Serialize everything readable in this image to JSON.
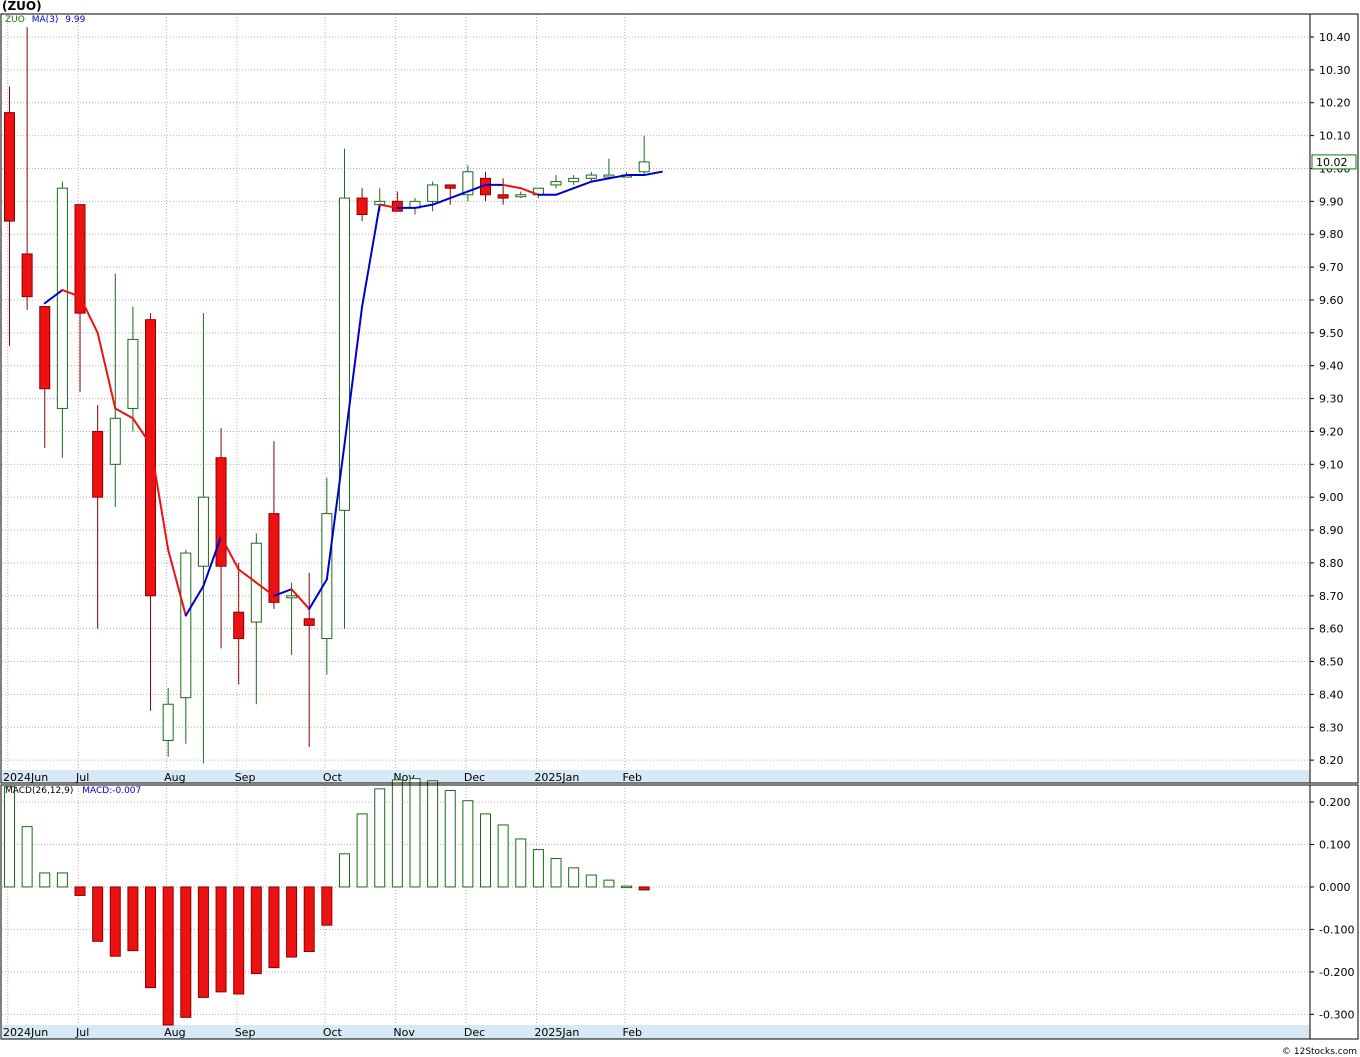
{
  "header": {
    "title": "(ZUO)"
  },
  "price_legend": {
    "symbol": "ZUO",
    "ma_label": "MA(3)",
    "ma_value": "9.99"
  },
  "macd_legend": {
    "label": "MACD(26,12,9)",
    "value": "MACD:-0.007"
  },
  "footer": {
    "credit": "© 12Stocks.com"
  },
  "colors": {
    "up_body": "#ffffff",
    "up_outline": "#1a6b1a",
    "down_body": "#ee1111",
    "down_wick": "#8b0000",
    "ma_up": "#0000cc",
    "ma_down": "#ee1111",
    "grid": "#b4b4b4",
    "axis_band": "#d7e9f5",
    "last_price_box": "#008000"
  },
  "chart_data": [
    {
      "type": "candlestick",
      "title": "(ZUO)",
      "interval": "weekly",
      "ylim": [
        8.17,
        10.47
      ],
      "y_ticks": [
        "8.20",
        "8.30",
        "8.40",
        "8.50",
        "8.60",
        "8.70",
        "8.80",
        "8.90",
        "9.00",
        "9.10",
        "9.20",
        "9.30",
        "9.40",
        "9.50",
        "9.60",
        "9.70",
        "9.80",
        "9.90",
        "10.00",
        "10.10",
        "10.20",
        "10.30",
        "10.40"
      ],
      "x_labels": [
        "2024Jun",
        "Jul",
        "Aug",
        "Sep",
        "Oct",
        "Nov",
        "Dec",
        "2025Jan",
        "Feb"
      ],
      "x_label_bars": [
        0,
        4,
        9,
        13,
        18,
        22,
        26,
        30,
        35
      ],
      "last_price": "10.02",
      "bars": [
        {
          "o": 10.17,
          "h": 10.25,
          "l": 9.46,
          "c": 9.84
        },
        {
          "o": 9.74,
          "h": 10.43,
          "l": 9.57,
          "c": 9.61
        },
        {
          "o": 9.58,
          "h": 9.58,
          "l": 9.15,
          "c": 9.33
        },
        {
          "o": 9.27,
          "h": 9.96,
          "l": 9.12,
          "c": 9.94
        },
        {
          "o": 9.89,
          "h": 9.89,
          "l": 9.32,
          "c": 9.56
        },
        {
          "o": 9.2,
          "h": 9.28,
          "l": 8.6,
          "c": 9.0
        },
        {
          "o": 9.1,
          "h": 9.68,
          "l": 8.97,
          "c": 9.24
        },
        {
          "o": 9.27,
          "h": 9.58,
          "l": 9.2,
          "c": 9.48
        },
        {
          "o": 9.54,
          "h": 9.56,
          "l": 8.35,
          "c": 8.7
        },
        {
          "o": 8.26,
          "h": 8.42,
          "l": 8.21,
          "c": 8.37
        },
        {
          "o": 8.39,
          "h": 8.84,
          "l": 8.25,
          "c": 8.83
        },
        {
          "o": 8.79,
          "h": 9.56,
          "l": 8.19,
          "c": 9.0
        },
        {
          "o": 9.12,
          "h": 9.21,
          "l": 8.54,
          "c": 8.79
        },
        {
          "o": 8.65,
          "h": 8.8,
          "l": 8.43,
          "c": 8.57
        },
        {
          "o": 8.62,
          "h": 8.89,
          "l": 8.37,
          "c": 8.86
        },
        {
          "o": 8.95,
          "h": 9.17,
          "l": 8.66,
          "c": 8.68
        },
        {
          "o": 8.7,
          "h": 8.74,
          "l": 8.52,
          "c": 8.7
        },
        {
          "o": 8.63,
          "h": 8.77,
          "l": 8.24,
          "c": 8.61
        },
        {
          "o": 8.57,
          "h": 9.06,
          "l": 8.46,
          "c": 8.95
        },
        {
          "o": 8.96,
          "h": 10.06,
          "l": 8.6,
          "c": 9.91
        },
        {
          "o": 9.91,
          "h": 9.94,
          "l": 9.84,
          "c": 9.86
        },
        {
          "o": 9.89,
          "h": 9.94,
          "l": 9.87,
          "c": 9.9
        },
        {
          "o": 9.9,
          "h": 9.93,
          "l": 9.87,
          "c": 9.87
        },
        {
          "o": 9.88,
          "h": 9.91,
          "l": 9.86,
          "c": 9.9
        },
        {
          "o": 9.9,
          "h": 9.96,
          "l": 9.87,
          "c": 9.95
        },
        {
          "o": 9.95,
          "h": 9.95,
          "l": 9.89,
          "c": 9.94
        },
        {
          "o": 9.92,
          "h": 10.01,
          "l": 9.9,
          "c": 9.99
        },
        {
          "o": 9.97,
          "h": 9.99,
          "l": 9.9,
          "c": 9.92
        },
        {
          "o": 9.92,
          "h": 9.97,
          "l": 9.89,
          "c": 9.91
        },
        {
          "o": 9.92,
          "h": 9.93,
          "l": 9.91,
          "c": 9.92
        },
        {
          "o": 9.92,
          "h": 9.94,
          "l": 9.91,
          "c": 9.94
        },
        {
          "o": 9.95,
          "h": 9.98,
          "l": 9.94,
          "c": 9.96
        },
        {
          "o": 9.96,
          "h": 9.98,
          "l": 9.95,
          "c": 9.97
        },
        {
          "o": 9.97,
          "h": 9.99,
          "l": 9.96,
          "c": 9.98
        },
        {
          "o": 9.98,
          "h": 10.03,
          "l": 9.97,
          "c": 9.98
        },
        {
          "o": 9.98,
          "h": 9.99,
          "l": 9.98,
          "c": 9.98
        },
        {
          "o": 9.99,
          "h": 10.1,
          "l": 9.98,
          "c": 10.02
        }
      ],
      "ma": {
        "name": "MA(3)",
        "start_index": 2,
        "values": [
          9.59,
          9.63,
          9.61,
          9.5,
          9.27,
          9.24,
          9.16,
          8.84,
          8.64,
          8.73,
          8.88,
          8.78,
          8.74,
          8.7,
          8.72,
          8.66,
          8.75,
          9.16,
          9.58,
          9.89,
          9.88,
          9.88,
          9.89,
          9.91,
          9.93,
          9.95,
          9.95,
          9.94,
          9.92,
          9.92,
          9.94,
          9.96,
          9.97,
          9.98,
          9.98,
          9.99
        ]
      }
    },
    {
      "type": "bar",
      "title": "MACD(26,12,9)",
      "ylim": [
        -0.325,
        0.24
      ],
      "y_ticks": [
        "0.200",
        "0.100",
        "0.000",
        "-0.100",
        "-0.200",
        "-0.300"
      ],
      "x_labels": [
        "2024Jun",
        "Jul",
        "Aug",
        "Sep",
        "Oct",
        "Nov",
        "Dec",
        "2025Jan",
        "Feb"
      ],
      "x_label_bars": [
        0,
        4,
        9,
        13,
        18,
        22,
        26,
        30,
        35
      ],
      "values": [
        0.236,
        0.142,
        0.033,
        0.033,
        -0.02,
        -0.128,
        -0.163,
        -0.15,
        -0.237,
        -0.325,
        -0.307,
        -0.26,
        -0.247,
        -0.252,
        -0.204,
        -0.19,
        -0.165,
        -0.152,
        -0.09,
        0.078,
        0.172,
        0.231,
        0.252,
        0.255,
        0.25,
        0.227,
        0.203,
        0.172,
        0.146,
        0.113,
        0.088,
        0.067,
        0.045,
        0.028,
        0.016,
        0.002,
        -0.007
      ]
    }
  ]
}
